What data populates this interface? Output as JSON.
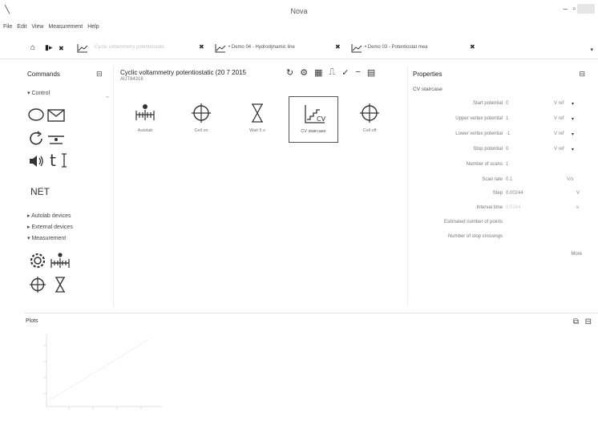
{
  "window": {
    "title": "Nova",
    "minimize": "–",
    "maximize": "▫"
  },
  "menu": [
    "File",
    "Edit",
    "View",
    "Measurement",
    "Help"
  ],
  "tabs": [
    {
      "label": "Cyclic voltammetry potentiostatic",
      "faded": true
    },
    {
      "label": "• Demo 04 - Hydrodynamic line",
      "faded": false
    },
    {
      "label": "• Demo 03 - Potentiostat mea",
      "faded": false
    }
  ],
  "tab_close": "✖",
  "tab_overflow": "▾",
  "commands": {
    "title": "Commands",
    "section_control": "▾ Control",
    "net_label": "NET",
    "section_autolab": "▸ Autolab devices",
    "section_external": "▸ External devices",
    "section_measurement": "▾ Measurement"
  },
  "procedure": {
    "title": "Cyclic voltammetry potentiostatic (20 7 2015",
    "subtitle": "AUT84316",
    "steps": [
      {
        "label": "Autolab",
        "icon": "autolab-icon"
      },
      {
        "label": "Cell on",
        "icon": "cell-on-icon"
      },
      {
        "label": "Wait 5 s",
        "icon": "hourglass-icon"
      },
      {
        "label": "CV staircase",
        "icon": "cv-staircase-icon",
        "selected": true
      },
      {
        "label": "Cell off",
        "icon": "cell-off-icon"
      }
    ]
  },
  "properties": {
    "title": "Properties",
    "subtitle": "CV staircase",
    "rows": [
      {
        "label": "Start potential",
        "value": "0",
        "unit": "V ref"
      },
      {
        "label": "Upper vertex potential",
        "value": "1",
        "unit": "V ref"
      },
      {
        "label": "Lower vertex potential",
        "value": "-1",
        "unit": "V ref"
      },
      {
        "label": "Stop potential",
        "value": "0",
        "unit": "V ref"
      },
      {
        "label": "Number of scans",
        "value": "1",
        "unit": ""
      },
      {
        "label": "Scan rate",
        "value": "0.1",
        "unit": "V/s"
      },
      {
        "label": "Step",
        "value": "0.00244",
        "unit": "V"
      },
      {
        "label": "Interval time",
        "value": "0.0244",
        "unit": "s"
      },
      {
        "label": "Estimated number of points",
        "value": "",
        "unit": ""
      },
      {
        "label": "Number of stop crossings",
        "value": "",
        "unit": ""
      }
    ],
    "more": "More"
  },
  "plots": {
    "title": "Plots"
  }
}
